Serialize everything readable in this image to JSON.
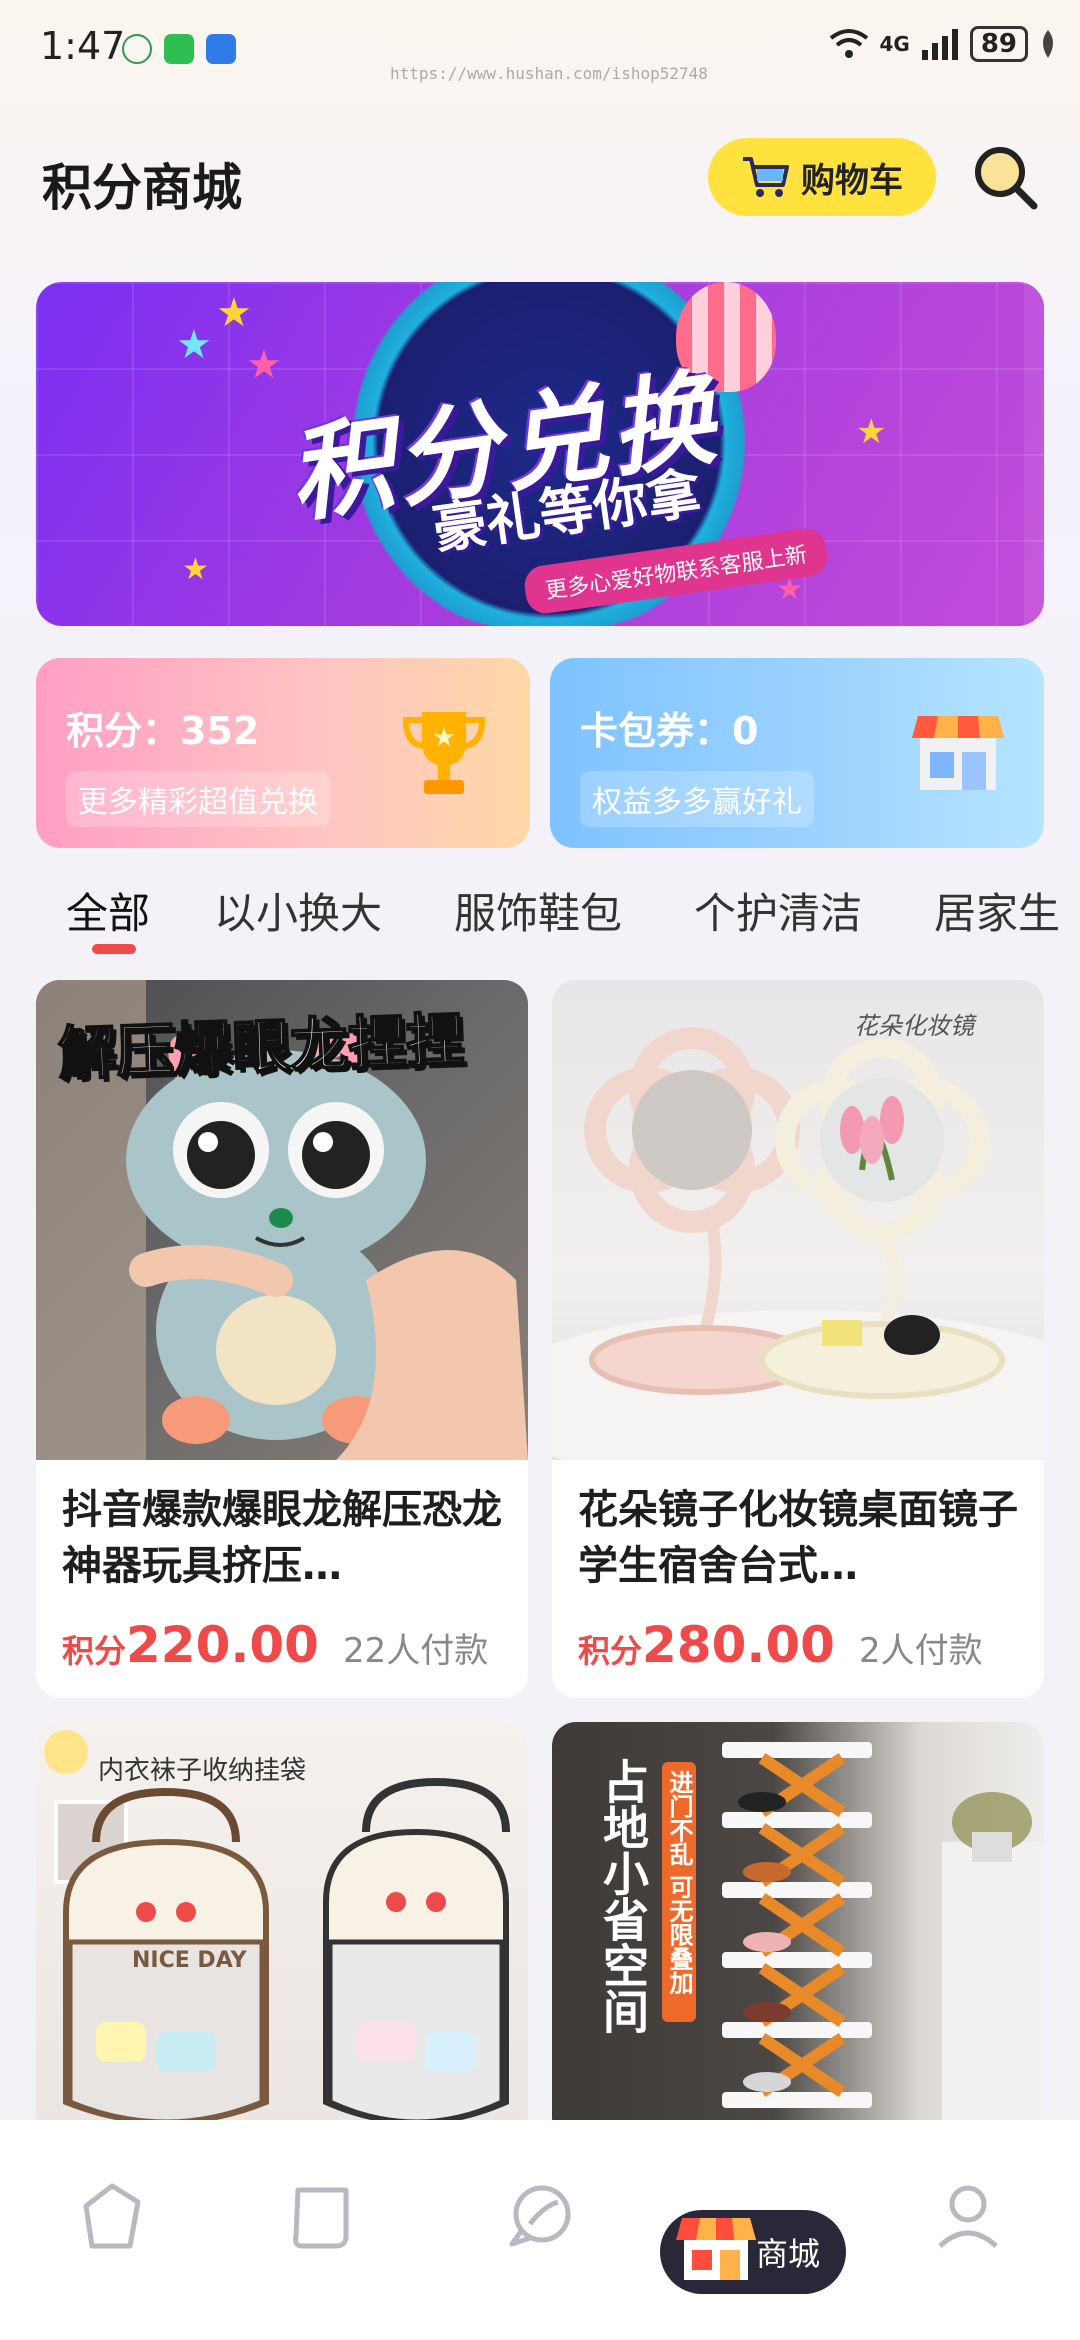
{
  "status_bar": {
    "time": "1:47",
    "network": "4G",
    "battery": "89",
    "url": "https://www.hushan.com/ishop52748"
  },
  "header": {
    "title": "积分商城",
    "cart_label": "购物车"
  },
  "banner": {
    "title": "积分兑换",
    "subtitle": "豪礼等你拿",
    "tag": "更多心爱好物联系客服上新"
  },
  "points_card": {
    "value": "积分：352",
    "subtitle": "更多精彩超值兑换"
  },
  "coupon_card": {
    "value": "卡包券：0",
    "subtitle": "权益多多赢好礼"
  },
  "tabs": [
    {
      "label": "全部",
      "active": true
    },
    {
      "label": "以小换大",
      "active": false
    },
    {
      "label": "服饰鞋包",
      "active": false
    },
    {
      "label": "个护清洁",
      "active": false
    },
    {
      "label": "居家生",
      "active": false
    }
  ],
  "products": [
    {
      "image_text": "解压爆眼龙捏捏",
      "title": "抖音爆款爆眼龙解压恐龙神器玩具挤压…",
      "price_prefix": "积分",
      "price": "220.00",
      "sold": "22人付款"
    },
    {
      "image_text": "花朵化妆镜",
      "title": "花朵镜子化妆镜桌面镜子学生宿舍台式…",
      "price_prefix": "积分",
      "price": "280.00",
      "sold": "2人付款"
    },
    {
      "image_text": "内衣袜子收纳挂袋",
      "image_badge": "NICE DAY"
    },
    {
      "image_text": "占地小省空间",
      "image_text_2": "进门不乱 可无限叠加"
    }
  ],
  "bottom_nav": {
    "active_label": "商城"
  },
  "colors": {
    "accent": "#ef4a4a",
    "cart_bg": "#ffe23d",
    "nav_active_bg": "#2a2738"
  }
}
